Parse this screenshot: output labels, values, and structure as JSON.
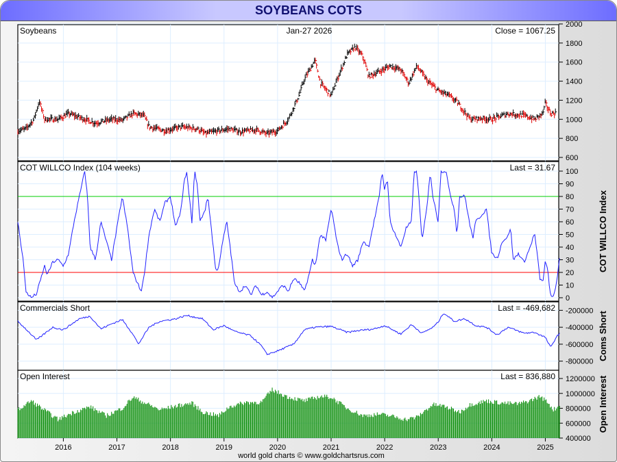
{
  "title": "SOYBEANS COTS",
  "footer": "world gold charts © www.goldchartsrus.com",
  "chart_data": [
    {
      "type": "ohlc",
      "name": "price",
      "label": "Soybeans",
      "date": "Jan-27  2026",
      "last_label": "Close = 1067.25",
      "ylim": [
        600,
        2000
      ],
      "yticks": [
        600,
        800,
        1000,
        1200,
        1400,
        1600,
        1800,
        2000
      ],
      "points": [
        [
          2015.1,
          870
        ],
        [
          2015.3,
          900
        ],
        [
          2015.45,
          1000
        ],
        [
          2015.55,
          1190
        ],
        [
          2015.65,
          1000
        ],
        [
          2015.9,
          1000
        ],
        [
          2016.1,
          1060
        ],
        [
          2016.3,
          1020
        ],
        [
          2016.6,
          960
        ],
        [
          2016.9,
          1000
        ],
        [
          2017.1,
          990
        ],
        [
          2017.3,
          1060
        ],
        [
          2017.5,
          1040
        ],
        [
          2017.6,
          920
        ],
        [
          2017.9,
          880
        ],
        [
          2018.2,
          920
        ],
        [
          2018.5,
          900
        ],
        [
          2018.65,
          850
        ],
        [
          2018.9,
          880
        ],
        [
          2019.1,
          900
        ],
        [
          2019.3,
          870
        ],
        [
          2019.6,
          890
        ],
        [
          2019.8,
          850
        ],
        [
          2020.0,
          880
        ],
        [
          2020.2,
          1000
        ],
        [
          2020.4,
          1250
        ],
        [
          2020.5,
          1420
        ],
        [
          2020.7,
          1620
        ],
        [
          2020.8,
          1380
        ],
        [
          2021.0,
          1250
        ],
        [
          2021.1,
          1400
        ],
        [
          2021.3,
          1680
        ],
        [
          2021.45,
          1760
        ],
        [
          2021.6,
          1650
        ],
        [
          2021.7,
          1450
        ],
        [
          2021.9,
          1500
        ],
        [
          2022.1,
          1560
        ],
        [
          2022.3,
          1520
        ],
        [
          2022.45,
          1380
        ],
        [
          2022.6,
          1560
        ],
        [
          2022.8,
          1400
        ],
        [
          2023.0,
          1300
        ],
        [
          2023.2,
          1250
        ],
        [
          2023.35,
          1180
        ],
        [
          2023.6,
          1000
        ],
        [
          2023.8,
          1010
        ],
        [
          2024.0,
          1000
        ],
        [
          2024.3,
          1060
        ],
        [
          2024.6,
          1040
        ],
        [
          2024.8,
          1000
        ],
        [
          2024.95,
          1060
        ],
        [
          2025.0,
          1170
        ],
        [
          2025.1,
          1060
        ],
        [
          2025.2,
          1067
        ]
      ]
    },
    {
      "type": "line",
      "name": "willco",
      "label": "COT WILLCO Index (104 weeks)",
      "last_label": "Last = 31.67",
      "axis_title": "COT WILLCO Index",
      "ylim": [
        0,
        100
      ],
      "yticks": [
        0,
        10,
        20,
        30,
        40,
        50,
        60,
        70,
        80,
        90,
        100
      ],
      "lines": {
        "upper": 80,
        "lower": 20
      },
      "colors": {
        "upper": "#00cc00",
        "lower": "#ff0000",
        "series": "#2020ff"
      },
      "points": [
        [
          2015.1,
          50
        ],
        [
          2015.15,
          60
        ],
        [
          2015.25,
          30
        ],
        [
          2015.3,
          5
        ],
        [
          2015.4,
          0
        ],
        [
          2015.5,
          3
        ],
        [
          2015.6,
          18
        ],
        [
          2015.65,
          25
        ],
        [
          2015.7,
          18
        ],
        [
          2015.8,
          28
        ],
        [
          2015.9,
          30
        ],
        [
          2016.0,
          25
        ],
        [
          2016.1,
          35
        ],
        [
          2016.2,
          60
        ],
        [
          2016.3,
          80
        ],
        [
          2016.4,
          100
        ],
        [
          2016.45,
          80
        ],
        [
          2016.5,
          40
        ],
        [
          2016.6,
          30
        ],
        [
          2016.7,
          60
        ],
        [
          2016.8,
          45
        ],
        [
          2016.9,
          30
        ],
        [
          2017.0,
          55
        ],
        [
          2017.1,
          80
        ],
        [
          2017.2,
          55
        ],
        [
          2017.3,
          20
        ],
        [
          2017.4,
          10
        ],
        [
          2017.45,
          5
        ],
        [
          2017.5,
          15
        ],
        [
          2017.6,
          50
        ],
        [
          2017.7,
          70
        ],
        [
          2017.8,
          60
        ],
        [
          2017.9,
          75
        ],
        [
          2018.0,
          80
        ],
        [
          2018.1,
          55
        ],
        [
          2018.2,
          70
        ],
        [
          2018.25,
          90
        ],
        [
          2018.3,
          100
        ],
        [
          2018.4,
          60
        ],
        [
          2018.45,
          100
        ],
        [
          2018.5,
          90
        ],
        [
          2018.55,
          60
        ],
        [
          2018.65,
          70
        ],
        [
          2018.7,
          80
        ],
        [
          2018.8,
          40
        ],
        [
          2018.85,
          20
        ],
        [
          2018.9,
          25
        ],
        [
          2019.0,
          50
        ],
        [
          2019.05,
          60
        ],
        [
          2019.1,
          45
        ],
        [
          2019.2,
          10
        ],
        [
          2019.3,
          5
        ],
        [
          2019.4,
          10
        ],
        [
          2019.5,
          2
        ],
        [
          2019.6,
          10
        ],
        [
          2019.7,
          2
        ],
        [
          2019.8,
          5
        ],
        [
          2019.9,
          0
        ],
        [
          2020.0,
          5
        ],
        [
          2020.1,
          10
        ],
        [
          2020.2,
          5
        ],
        [
          2020.3,
          15
        ],
        [
          2020.4,
          12
        ],
        [
          2020.5,
          5
        ],
        [
          2020.6,
          20
        ],
        [
          2020.65,
          30
        ],
        [
          2020.7,
          25
        ],
        [
          2020.8,
          50
        ],
        [
          2020.9,
          45
        ],
        [
          2021.0,
          70
        ],
        [
          2021.05,
          60
        ],
        [
          2021.1,
          45
        ],
        [
          2021.2,
          30
        ],
        [
          2021.3,
          35
        ],
        [
          2021.4,
          25
        ],
        [
          2021.5,
          30
        ],
        [
          2021.6,
          45
        ],
        [
          2021.7,
          40
        ],
        [
          2021.8,
          60
        ],
        [
          2021.9,
          80
        ],
        [
          2021.95,
          100
        ],
        [
          2022.0,
          85
        ],
        [
          2022.05,
          95
        ],
        [
          2022.1,
          60
        ],
        [
          2022.2,
          50
        ],
        [
          2022.3,
          40
        ],
        [
          2022.4,
          55
        ],
        [
          2022.5,
          60
        ],
        [
          2022.55,
          100
        ],
        [
          2022.6,
          100
        ],
        [
          2022.7,
          45
        ],
        [
          2022.8,
          75
        ],
        [
          2022.85,
          100
        ],
        [
          2022.9,
          80
        ],
        [
          2023.0,
          60
        ],
        [
          2023.05,
          100
        ],
        [
          2023.15,
          100
        ],
        [
          2023.2,
          85
        ],
        [
          2023.3,
          70
        ],
        [
          2023.35,
          50
        ],
        [
          2023.4,
          80
        ],
        [
          2023.5,
          80
        ],
        [
          2023.6,
          55
        ],
        [
          2023.65,
          48
        ],
        [
          2023.7,
          60
        ],
        [
          2023.8,
          65
        ],
        [
          2023.9,
          70
        ],
        [
          2024.0,
          35
        ],
        [
          2024.1,
          31
        ],
        [
          2024.2,
          45
        ],
        [
          2024.3,
          48
        ],
        [
          2024.35,
          56
        ],
        [
          2024.4,
          30
        ],
        [
          2024.5,
          35
        ],
        [
          2024.6,
          28
        ],
        [
          2024.7,
          38
        ],
        [
          2024.8,
          51
        ],
        [
          2024.9,
          15
        ],
        [
          2024.95,
          12
        ],
        [
          2025.0,
          29
        ],
        [
          2025.05,
          20
        ],
        [
          2025.1,
          0
        ],
        [
          2025.15,
          1
        ],
        [
          2025.2,
          10
        ],
        [
          2025.27,
          31.67
        ]
      ]
    },
    {
      "type": "line",
      "name": "coms",
      "label": "Commercials Short",
      "last_label": "Last = -469,682",
      "axis_title": "Coms Short",
      "ylim": [
        -900000,
        -100000
      ],
      "yticks": [
        -800000,
        -600000,
        -400000,
        -200000
      ],
      "tick_labels": [
        "-800000",
        "-600000",
        "-400000",
        "-200000"
      ],
      "colors": {
        "series": "#2020ff"
      },
      "points": [
        [
          2015.1,
          -300000
        ],
        [
          2015.3,
          -420000
        ],
        [
          2015.5,
          -550000
        ],
        [
          2015.6,
          -500000
        ],
        [
          2015.8,
          -400000
        ],
        [
          2016.0,
          -430000
        ],
        [
          2016.3,
          -300000
        ],
        [
          2016.5,
          -270000
        ],
        [
          2016.7,
          -420000
        ],
        [
          2016.9,
          -360000
        ],
        [
          2017.1,
          -310000
        ],
        [
          2017.3,
          -480000
        ],
        [
          2017.4,
          -600000
        ],
        [
          2017.6,
          -400000
        ],
        [
          2017.8,
          -330000
        ],
        [
          2018.1,
          -300000
        ],
        [
          2018.3,
          -260000
        ],
        [
          2018.6,
          -300000
        ],
        [
          2018.8,
          -430000
        ],
        [
          2019.0,
          -380000
        ],
        [
          2019.2,
          -450000
        ],
        [
          2019.5,
          -500000
        ],
        [
          2019.7,
          -620000
        ],
        [
          2019.8,
          -720000
        ],
        [
          2020.0,
          -680000
        ],
        [
          2020.3,
          -600000
        ],
        [
          2020.5,
          -430000
        ],
        [
          2020.7,
          -400000
        ],
        [
          2021.0,
          -390000
        ],
        [
          2021.3,
          -460000
        ],
        [
          2021.5,
          -440000
        ],
        [
          2021.8,
          -420000
        ],
        [
          2022.0,
          -380000
        ],
        [
          2022.3,
          -480000
        ],
        [
          2022.5,
          -370000
        ],
        [
          2022.7,
          -470000
        ],
        [
          2022.9,
          -400000
        ],
        [
          2023.0,
          -340000
        ],
        [
          2023.1,
          -230000
        ],
        [
          2023.3,
          -330000
        ],
        [
          2023.5,
          -300000
        ],
        [
          2023.7,
          -380000
        ],
        [
          2023.9,
          -400000
        ],
        [
          2024.1,
          -490000
        ],
        [
          2024.3,
          -400000
        ],
        [
          2024.6,
          -470000
        ],
        [
          2024.8,
          -460000
        ],
        [
          2025.0,
          -520000
        ],
        [
          2025.1,
          -640000
        ],
        [
          2025.2,
          -520000
        ],
        [
          2025.27,
          -469682
        ]
      ]
    },
    {
      "type": "bar",
      "name": "oi",
      "label": "Open Interest",
      "last_label": "Last = 836,880",
      "axis_title": "Open Interest",
      "ylim": [
        400000,
        1200000
      ],
      "yticks": [
        400000,
        600000,
        800000,
        1000000,
        1200000
      ],
      "colors": {
        "series": "#109010"
      },
      "points": [
        [
          2015.1,
          750000
        ],
        [
          2015.4,
          900000
        ],
        [
          2015.6,
          800000
        ],
        [
          2015.9,
          650000
        ],
        [
          2016.2,
          750000
        ],
        [
          2016.5,
          820000
        ],
        [
          2016.8,
          700000
        ],
        [
          2017.1,
          800000
        ],
        [
          2017.3,
          950000
        ],
        [
          2017.5,
          880000
        ],
        [
          2017.8,
          780000
        ],
        [
          2018.1,
          830000
        ],
        [
          2018.4,
          870000
        ],
        [
          2018.6,
          750000
        ],
        [
          2018.9,
          700000
        ],
        [
          2019.1,
          820000
        ],
        [
          2019.4,
          880000
        ],
        [
          2019.7,
          880000
        ],
        [
          2019.9,
          1050000
        ],
        [
          2020.2,
          950000
        ],
        [
          2020.5,
          900000
        ],
        [
          2020.8,
          960000
        ],
        [
          2021.0,
          950000
        ],
        [
          2021.3,
          800000
        ],
        [
          2021.6,
          700000
        ],
        [
          2021.9,
          720000
        ],
        [
          2022.1,
          700000
        ],
        [
          2022.4,
          650000
        ],
        [
          2022.6,
          680000
        ],
        [
          2022.9,
          850000
        ],
        [
          2023.1,
          830000
        ],
        [
          2023.4,
          750000
        ],
        [
          2023.6,
          850000
        ],
        [
          2023.9,
          900000
        ],
        [
          2024.2,
          870000
        ],
        [
          2024.5,
          860000
        ],
        [
          2024.7,
          900000
        ],
        [
          2024.9,
          960000
        ],
        [
          2025.05,
          880000
        ],
        [
          2025.15,
          780000
        ],
        [
          2025.27,
          836880
        ]
      ]
    },
    {
      "type": "axis",
      "name": "x",
      "xlim": [
        2015.15,
        2025.25
      ],
      "ticks": [
        2016,
        2017,
        2018,
        2019,
        2020,
        2021,
        2022,
        2023,
        2024,
        2025
      ],
      "tick_labels": [
        "2016",
        "2017",
        "2018",
        "2019",
        "2020",
        "2021",
        "2022",
        "2023",
        "2024",
        "2025"
      ]
    }
  ]
}
